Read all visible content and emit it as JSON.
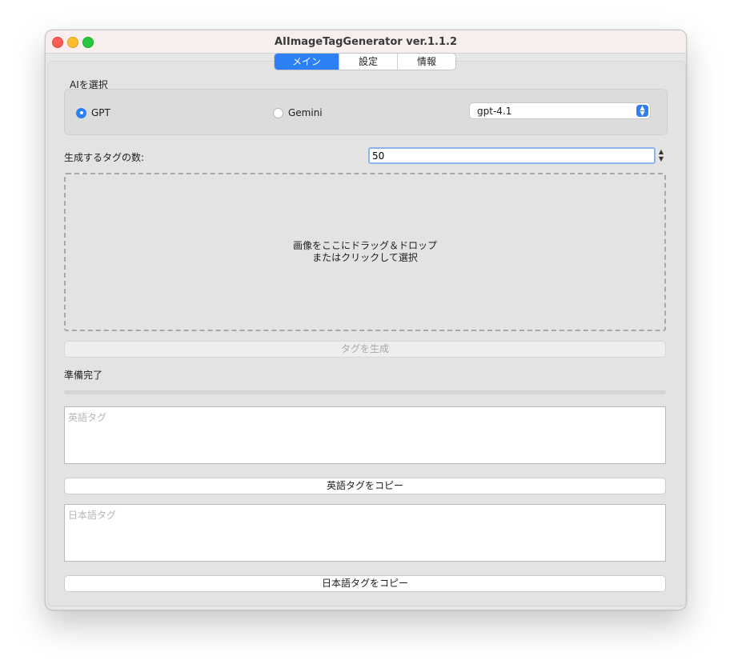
{
  "window": {
    "title": "AIImageTagGenerator ver.1.1.2"
  },
  "tabs": [
    {
      "label": "メイン",
      "active": true
    },
    {
      "label": "設定",
      "active": false
    },
    {
      "label": "情報",
      "active": false
    }
  ],
  "ai_group": {
    "label": "AIを選択",
    "options": [
      {
        "label": "GPT",
        "checked": true
      },
      {
        "label": "Gemini",
        "checked": false
      }
    ],
    "model_select": {
      "value": "gpt-4.1"
    }
  },
  "tag_count": {
    "label": "生成するタグの数:",
    "value": "50"
  },
  "dropzone": {
    "line1": "画像をここにドラッグ＆ドロップ",
    "line2": "またはクリックして選択"
  },
  "generate_button": {
    "label": "タグを生成",
    "enabled": false
  },
  "status": {
    "text": "準備完了"
  },
  "progress": {
    "value": 0
  },
  "english_tags": {
    "placeholder": "英語タグ",
    "copy_label": "英語タグをコピー"
  },
  "japanese_tags": {
    "placeholder": "日本語タグ",
    "copy_label": "日本語タグをコピー"
  },
  "colors": {
    "accent": "#2d7ff6"
  }
}
